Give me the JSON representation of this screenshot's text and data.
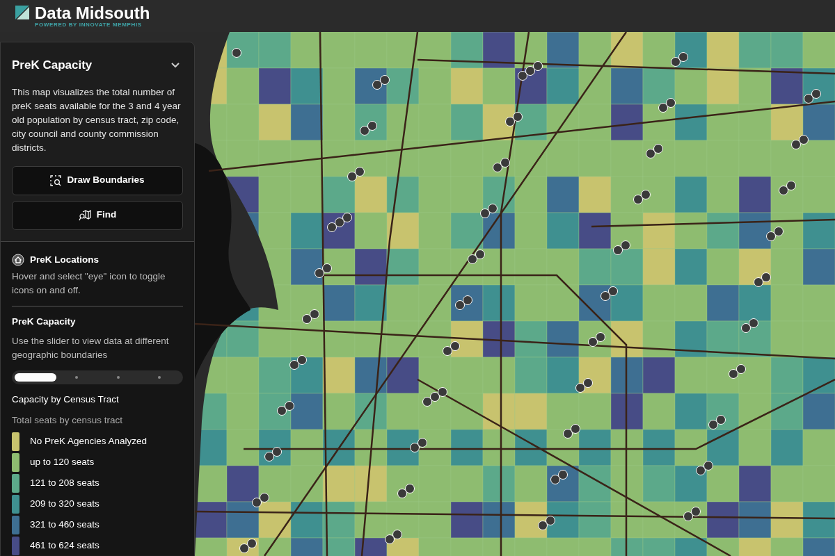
{
  "header": {
    "logo_text": "Data Midsouth",
    "tagline": "POWERED BY INNOVATE MEMPHIS"
  },
  "panel": {
    "title": "PreK Capacity",
    "expanded": true,
    "description": "This map visualizes the total number of preK seats available for the 3 and 4 year old population by census tract, zip code, city council and county commission districts.",
    "buttons": [
      {
        "kind": "draw",
        "label": "Draw Boundaries"
      },
      {
        "kind": "find",
        "label": "Find"
      }
    ]
  },
  "locations": {
    "title": "PreK Locations",
    "hint": "Hover and select \"eye\" icon to toggle icons on and off."
  },
  "capacity": {
    "title": "PreK Capacity",
    "hint": "Use the slider to view data at different geographic boundaries",
    "slider_stops": [
      {
        "selected": true
      },
      {
        "selected": false
      },
      {
        "selected": false
      },
      {
        "selected": false
      }
    ],
    "legend_title": "Capacity by Census Tract",
    "legend_subtitle": "Total seats by census tract",
    "legend": [
      {
        "label": "No PreK Agencies Analyzed",
        "color": "#c8c36e"
      },
      {
        "label": "up to 120 seats",
        "color": "#8ebc70"
      },
      {
        "label": "121 to 208 seats",
        "color": "#5ca98a"
      },
      {
        "label": "209 to 320 seats",
        "color": "#3f9090"
      },
      {
        "label": "321 to 460 seats",
        "color": "#3e6f92"
      },
      {
        "label": "461 to 624 seats",
        "color": "#474c86"
      }
    ]
  }
}
